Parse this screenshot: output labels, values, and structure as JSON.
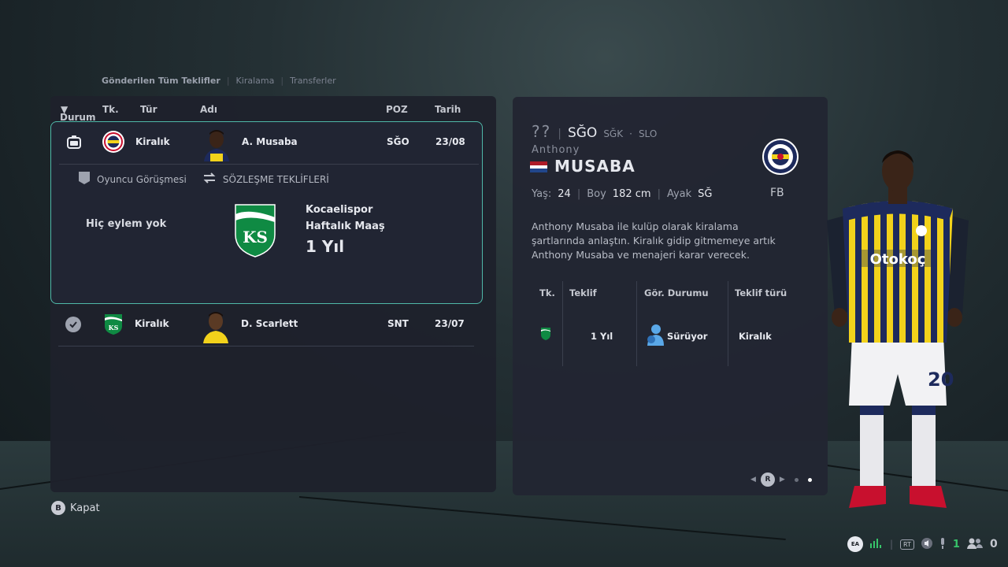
{
  "breadcrumb": {
    "items": [
      "Gönderilen Tüm Teklifler",
      "Kiralama",
      "Transferler"
    ]
  },
  "table": {
    "headers": {
      "status": "Durum",
      "status_sort": "▼",
      "club": "Tk.",
      "type": "Tür",
      "name": "Adı",
      "pos": "POZ",
      "date": "Tarih"
    },
    "rows": [
      {
        "type": "Kiralık",
        "name": "A. Musaba",
        "pos": "SĞO",
        "date": "23/08",
        "status_icon": "negotiation-icon",
        "club_icon": "fenerbahce-crest"
      },
      {
        "type": "Kiralık",
        "name": "D. Scarlett",
        "pos": "SNT",
        "date": "23/07",
        "status_icon": "check-icon",
        "club_icon": "kocaelispor-crest"
      }
    ]
  },
  "expanded": {
    "tab_interview": "Oyuncu Görüşmesi",
    "tab_contract": "SÖZLEŞME TEKLİFLERİ",
    "no_action": "Hiç eylem yok",
    "offer_club": "Kocaelispor",
    "offer_wage": "Haftalık Maaş",
    "offer_duration": "1 Yıl",
    "crest_letters": "KS"
  },
  "player": {
    "unknown_rating": "??",
    "main_pos": "SĞO",
    "alt_pos_1": "SĞK",
    "alt_pos_2": "SLO",
    "first_name": "Anthony",
    "last_name": "MUSABA",
    "age_label": "Yaş:",
    "age": "24",
    "height_label": "Boy",
    "height": "182 cm",
    "foot_label": "Ayak",
    "foot": "SĞ",
    "club_short": "FB",
    "description": "Anthony Musaba ile kulüp olarak kiralama şartlarında anlaştın. Kiralık gidip gitmemeye artık Anthony Musaba ve menajeri karar verecek.",
    "flag_colors": [
      "#ae1c28",
      "#ffffff",
      "#21468b"
    ],
    "jersey_number": "20",
    "sponsor": "Otokoç"
  },
  "offer_table": {
    "headers": {
      "club": "Tk.",
      "offer": "Teklif",
      "status": "Gör. Durumu",
      "type": "Teklif türü"
    },
    "row": {
      "offer": "1 Yıl",
      "status": "Sürüyor",
      "type": "Kiralık"
    }
  },
  "pager": {
    "button": "R"
  },
  "footer": {
    "close_button": "B",
    "close_label": "Kapat",
    "ea_label": "EA",
    "rt_label": "RT",
    "count_green": "1",
    "count_friends": "0"
  },
  "colors": {
    "accent_teal": "#4fb8a8",
    "panel": "#1e212c",
    "fb_navy": "#1d2a5c",
    "fb_yellow": "#f2d21b",
    "ks_green": "#0f8a43"
  }
}
